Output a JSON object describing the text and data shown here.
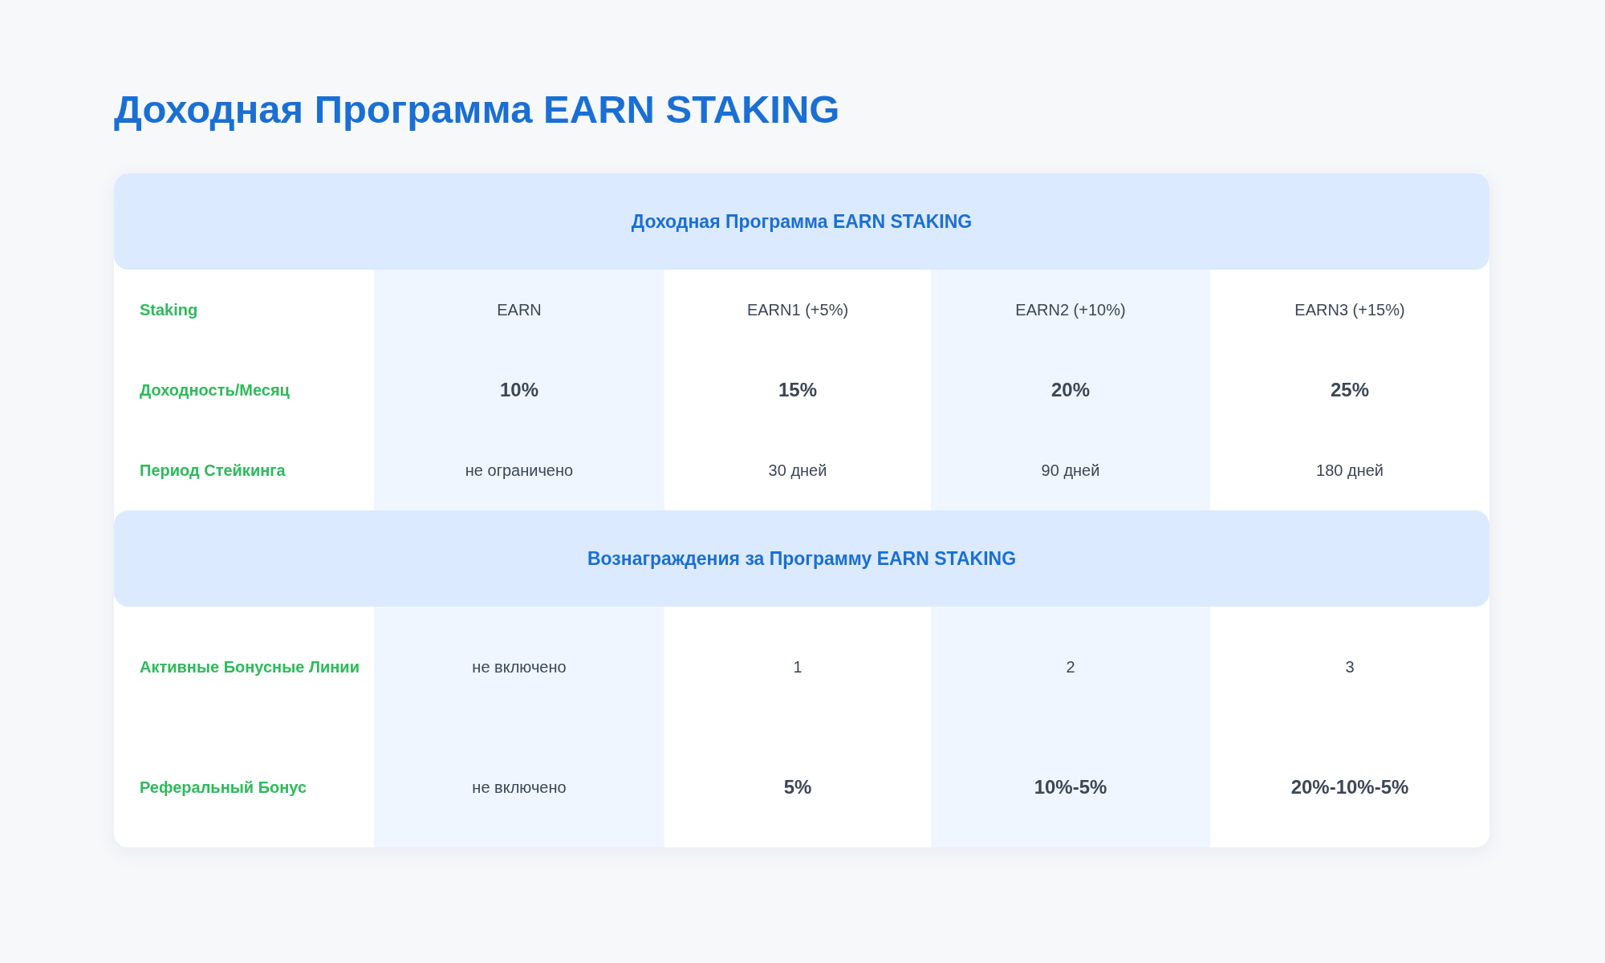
{
  "title": "Доходная Программа EARN STAKING",
  "sections": [
    {
      "header": "Доходная Программа EARN STAKING",
      "rows": [
        {
          "label": "Staking",
          "cells": [
            {
              "text": "EARN",
              "strong": false
            },
            {
              "text": "EARN1 (+5%)",
              "strong": false
            },
            {
              "text": "EARN2 (+10%)",
              "strong": false
            },
            {
              "text": "EARN3 (+15%)",
              "strong": false
            }
          ]
        },
        {
          "label": "Доходность/Месяц",
          "cells": [
            {
              "text": "10%",
              "strong": true
            },
            {
              "text": "15%",
              "strong": true
            },
            {
              "text": "20%",
              "strong": true
            },
            {
              "text": "25%",
              "strong": true
            }
          ]
        },
        {
          "label": "Период Стейкинга",
          "cells": [
            {
              "text": "не ограничено",
              "strong": false
            },
            {
              "text": "30 дней",
              "strong": false
            },
            {
              "text": "90 дней",
              "strong": false
            },
            {
              "text": "180 дней",
              "strong": false
            }
          ]
        }
      ]
    },
    {
      "header": "Вознаграждения за Программу EARN STAKING",
      "rows": [
        {
          "label": "Активные Бонусные Линии",
          "cells": [
            {
              "text": "не включено",
              "strong": false
            },
            {
              "text": "1",
              "strong": false
            },
            {
              "text": "2",
              "strong": false
            },
            {
              "text": "3",
              "strong": false
            }
          ]
        },
        {
          "label": "Реферальный Бонус",
          "cells": [
            {
              "text": "не включено",
              "strong": false
            },
            {
              "text": "5%",
              "strong": true
            },
            {
              "text": "10%-5%",
              "strong": true
            },
            {
              "text": "20%-10%-5%",
              "strong": true
            }
          ]
        }
      ]
    }
  ]
}
